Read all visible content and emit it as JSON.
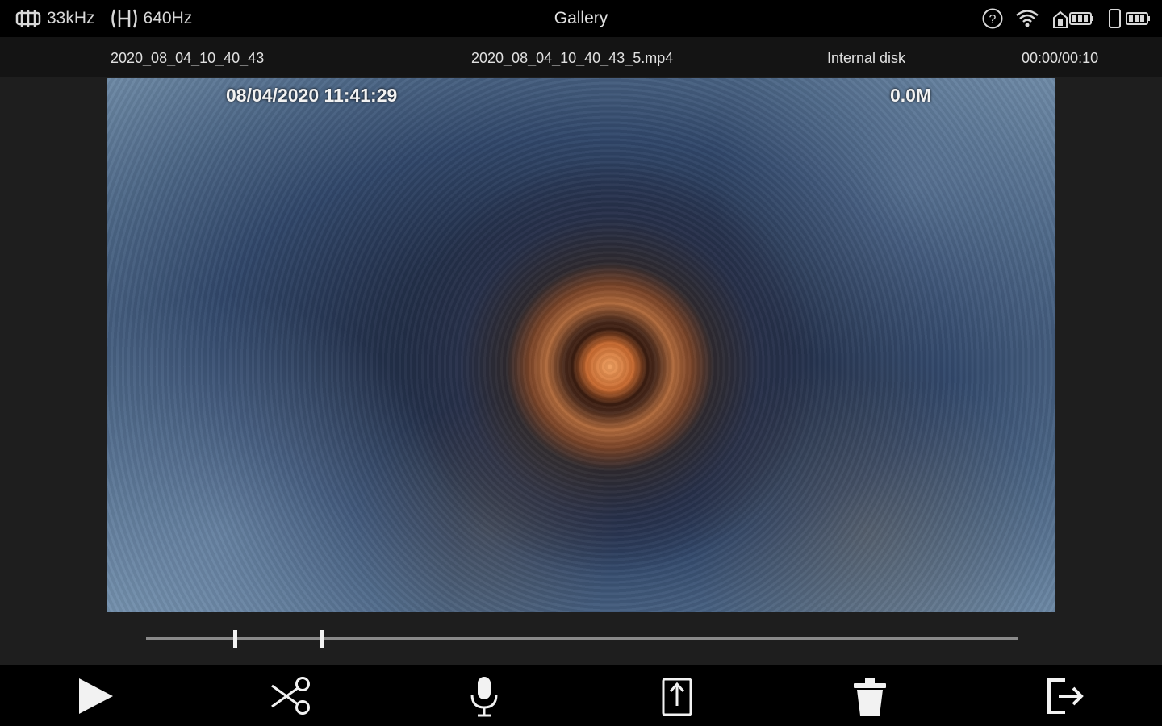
{
  "status_bar": {
    "frequency_1": "33kHz",
    "frequency_2": "640Hz",
    "title": "Gallery",
    "icons": [
      "sonde-frequency-icon",
      "transmitter-frequency-icon",
      "help-icon",
      "wifi-icon",
      "device-battery-icon",
      "phone-battery-icon"
    ]
  },
  "file_info": {
    "folder": "2020_08_04_10_40_43",
    "filename": "2020_08_04_10_40_43_5.mp4",
    "storage": "Internal disk",
    "time": "00:00/00:10"
  },
  "video": {
    "timestamp": "08/04/2020  11:41:29",
    "size": "0.0M"
  },
  "timeline": {
    "marker_positions": [
      0.102,
      0.202
    ],
    "progress": 0
  },
  "toolbar": {
    "buttons": [
      "play",
      "trim",
      "microphone",
      "export",
      "delete",
      "exit"
    ]
  },
  "colors": {
    "background": "#1e1e1e",
    "bar": "#000000",
    "text": "#e6e6e6",
    "track": "#8a8a8a"
  }
}
